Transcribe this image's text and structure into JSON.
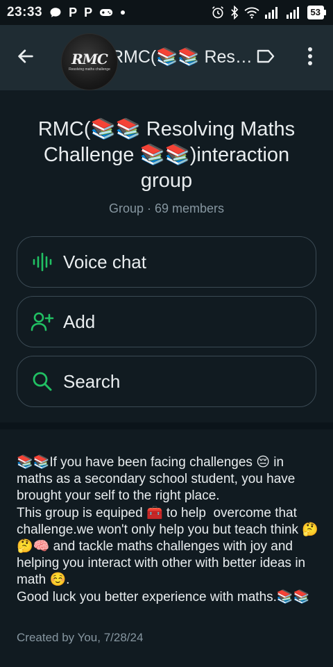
{
  "status_bar": {
    "time": "23:33",
    "left_icons": [
      "chat-bubble-icon",
      "p-app-icon",
      "p-app-icon",
      "game-controller-icon",
      "dot-icon"
    ],
    "p1": "P",
    "p2": "P",
    "battery": "53"
  },
  "app_bar": {
    "title": "RMC(📚📚 Resolving Maths Challenge 📚📚)interaction group",
    "avatar_logo": "RMC",
    "avatar_subtext": "Resolving maths challenge"
  },
  "group_info": {
    "name": "RMC(📚📚 Resolving Maths Challenge 📚📚)interaction group",
    "meta": "Group · 69 members"
  },
  "actions": [
    {
      "label": "Voice chat",
      "icon": "voice-wave-icon"
    },
    {
      "label": "Add",
      "icon": "add-person-icon"
    },
    {
      "label": "Search",
      "icon": "search-icon"
    }
  ],
  "description": {
    "text": "📚📚If you have been facing challenges 😔 in maths as a secondary school student, you have brought your self to the right place.\nThis group is equiped 🧰 to help  overcome that challenge.we won't only help you but teach think 🤔🤔🧠 and tackle maths challenges with joy and helping you interact with other with better ideas in math ☺️.\nGood luck you better experience with maths.📚📚",
    "created_by": "Created by You, 7/28/24"
  },
  "colors": {
    "accent": "#21c063",
    "background": "#0b141a",
    "panel": "#111b21",
    "app_bar": "#1f2c33",
    "secondary_text": "#8696a0",
    "border": "#3b4a54"
  }
}
